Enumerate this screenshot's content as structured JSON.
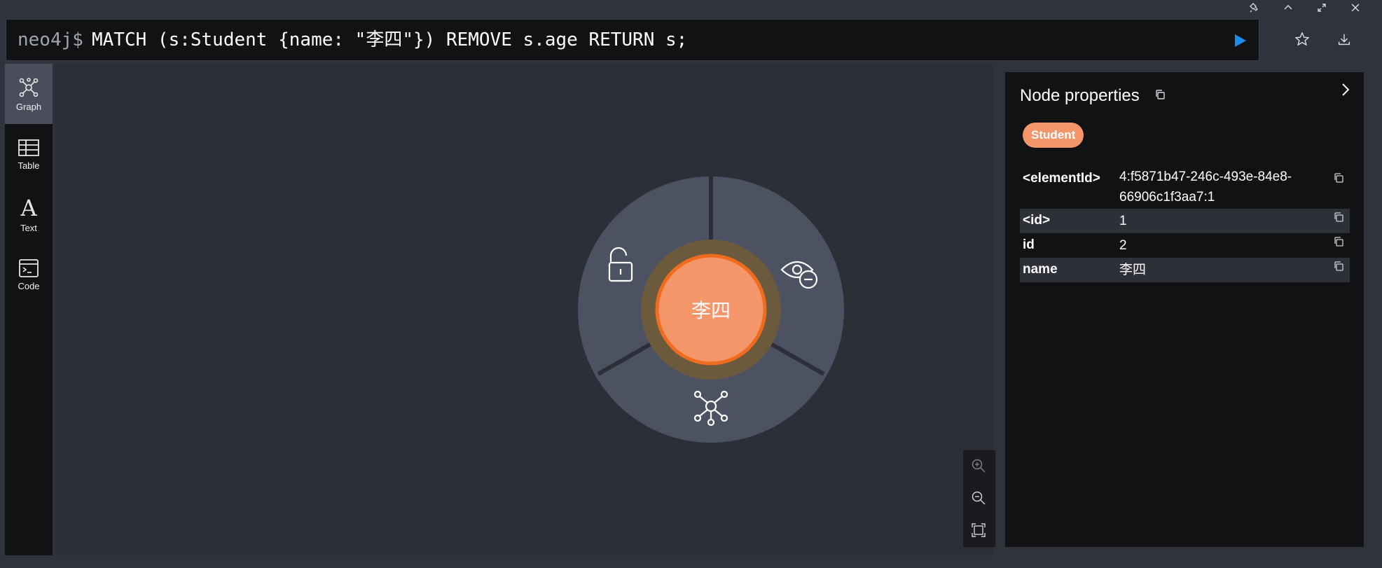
{
  "editor": {
    "prompt": "neo4j$",
    "query": "MATCH (s:Student {name: \"李四\"}) REMOVE s.age RETURN s;"
  },
  "window_controls": [
    {
      "name": "pin-icon"
    },
    {
      "name": "chevron-up-icon"
    },
    {
      "name": "expand-icon"
    },
    {
      "name": "close-icon"
    }
  ],
  "toolbar": {
    "run_icon": "play-icon",
    "favorite_icon": "star-icon",
    "download_icon": "download-icon"
  },
  "sidebar": {
    "items": [
      {
        "label": "Graph",
        "icon": "graph-icon",
        "active": true
      },
      {
        "label": "Table",
        "icon": "table-icon",
        "active": false
      },
      {
        "label": "Text",
        "icon": "text-icon",
        "active": false
      },
      {
        "label": "Code",
        "icon": "code-icon",
        "active": false
      }
    ]
  },
  "graph": {
    "node": {
      "label": "李四",
      "color": "#f5956a",
      "border_color": "#ef6c1f"
    },
    "ring_color": "#4d5263",
    "halo_color": "#6b5a3c",
    "actions": [
      "unlock-icon",
      "hide-icon",
      "expand-relationships-icon"
    ]
  },
  "zoom": {
    "controls": [
      "zoom-in-icon",
      "zoom-out-icon",
      "fit-icon"
    ]
  },
  "panel": {
    "title": "Node properties",
    "label_badge": "Student",
    "label_color": "#f5956a",
    "properties": [
      {
        "key": "<elementId>",
        "value": "4:f5871b47-246c-493e-84e8-66906c1f3aa7:1"
      },
      {
        "key": "<id>",
        "value": "1"
      },
      {
        "key": "id",
        "value": "2"
      },
      {
        "key": "name",
        "value": "李四"
      }
    ]
  }
}
